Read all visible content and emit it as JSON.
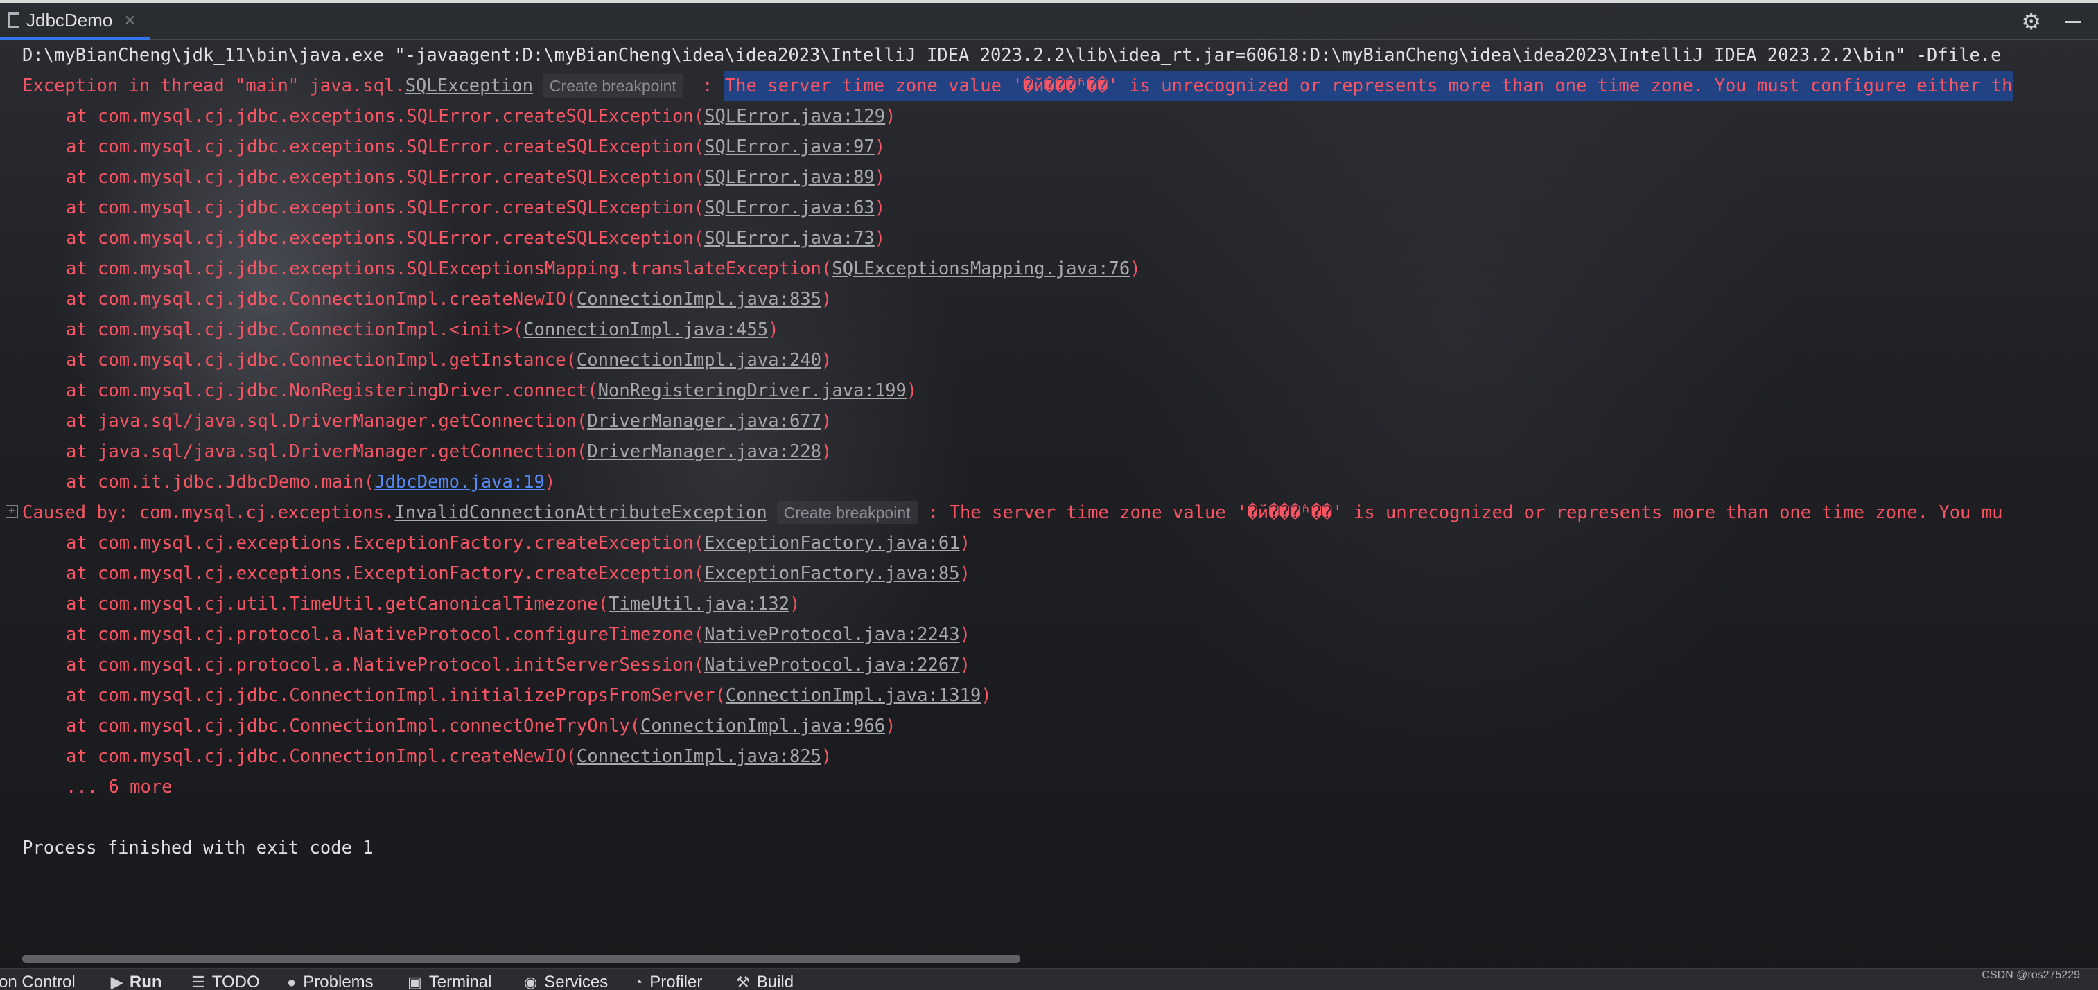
{
  "tab": {
    "label": "JdbcDemo",
    "close": "×"
  },
  "toolbar": {
    "settings_icon": "gear-icon",
    "minimize_icon": "minimize-icon"
  },
  "console": {
    "command_line": "D:\\myBianCheng\\jdk_11\\bin\\java.exe \"-javaagent:D:\\myBianCheng\\idea\\idea2023\\IntelliJ IDEA 2023.2.2\\lib\\idea_rt.jar=60618:D:\\myBianCheng\\idea\\idea2023\\IntelliJ IDEA 2023.2.2\\bin\" -Dfile.e",
    "exception": {
      "prefix": "Exception in thread \"main\" java.sql.",
      "class_link": "SQLException",
      "breakpoint": "Create breakpoint",
      "separator": " : ",
      "message": "The server time zone value '�й���ʱ��' is unrecognized or represents more than one time zone. You must configure either th"
    },
    "stack1": [
      {
        "text": "at com.mysql.cj.jdbc.exceptions.SQLError.createSQLException(",
        "link": "SQLError.java:129"
      },
      {
        "text": "at com.mysql.cj.jdbc.exceptions.SQLError.createSQLException(",
        "link": "SQLError.java:97"
      },
      {
        "text": "at com.mysql.cj.jdbc.exceptions.SQLError.createSQLException(",
        "link": "SQLError.java:89"
      },
      {
        "text": "at com.mysql.cj.jdbc.exceptions.SQLError.createSQLException(",
        "link": "SQLError.java:63"
      },
      {
        "text": "at com.mysql.cj.jdbc.exceptions.SQLError.createSQLException(",
        "link": "SQLError.java:73"
      },
      {
        "text": "at com.mysql.cj.jdbc.exceptions.SQLExceptionsMapping.translateException(",
        "link": "SQLExceptionsMapping.java:76"
      },
      {
        "text": "at com.mysql.cj.jdbc.ConnectionImpl.createNewIO(",
        "link": "ConnectionImpl.java:835"
      },
      {
        "text": "at com.mysql.cj.jdbc.ConnectionImpl.<init>(",
        "link": "ConnectionImpl.java:455"
      },
      {
        "text": "at com.mysql.cj.jdbc.ConnectionImpl.getInstance(",
        "link": "ConnectionImpl.java:240"
      },
      {
        "text": "at com.mysql.cj.jdbc.NonRegisteringDriver.connect(",
        "link": "NonRegisteringDriver.java:199"
      },
      {
        "text": "at java.sql/java.sql.DriverManager.getConnection(",
        "link": "DriverManager.java:677"
      },
      {
        "text": "at java.sql/java.sql.DriverManager.getConnection(",
        "link": "DriverManager.java:228"
      },
      {
        "text": "at com.it.jdbc.JdbcDemo.main(",
        "link": "JdbcDemo.java:19"
      }
    ],
    "caused_by": {
      "prefix": "Caused by: com.mysql.cj.exceptions.",
      "class_link": "InvalidConnectionAttributeException",
      "breakpoint": "Create breakpoint",
      "message": " : The server time zone value '�й���ʱ��' is unrecognized or represents more than one time zone. You mu"
    },
    "stack2": [
      {
        "text": "at com.mysql.cj.exceptions.ExceptionFactory.createException(",
        "link": "ExceptionFactory.java:61"
      },
      {
        "text": "at com.mysql.cj.exceptions.ExceptionFactory.createException(",
        "link": "ExceptionFactory.java:85"
      },
      {
        "text": "at com.mysql.cj.util.TimeUtil.getCanonicalTimezone(",
        "link": "TimeUtil.java:132"
      },
      {
        "text": "at com.mysql.cj.protocol.a.NativeProtocol.configureTimezone(",
        "link": "NativeProtocol.java:2243"
      },
      {
        "text": "at com.mysql.cj.protocol.a.NativeProtocol.initServerSession(",
        "link": "NativeProtocol.java:2267"
      },
      {
        "text": "at com.mysql.cj.jdbc.ConnectionImpl.initializePropsFromServer(",
        "link": "ConnectionImpl.java:1319"
      },
      {
        "text": "at com.mysql.cj.jdbc.ConnectionImpl.connectOneTryOnly(",
        "link": "ConnectionImpl.java:966"
      },
      {
        "text": "at com.mysql.cj.jdbc.ConnectionImpl.createNewIO(",
        "link": "ConnectionImpl.java:825"
      }
    ],
    "more": "... 6 more",
    "finished": "Process finished with exit code 1"
  },
  "bottom_bar": {
    "version_control": "on Control",
    "run": "Run",
    "todo": "TODO",
    "problems": "Problems",
    "terminal": "Terminal",
    "services": "Services",
    "profiler": "Profiler",
    "build": "Build"
  },
  "watermark": "CSDN @ros275229",
  "colors": {
    "error": "#f75464",
    "selection": "#214283",
    "accent": "#3574f0",
    "link_blue": "#548af7"
  }
}
